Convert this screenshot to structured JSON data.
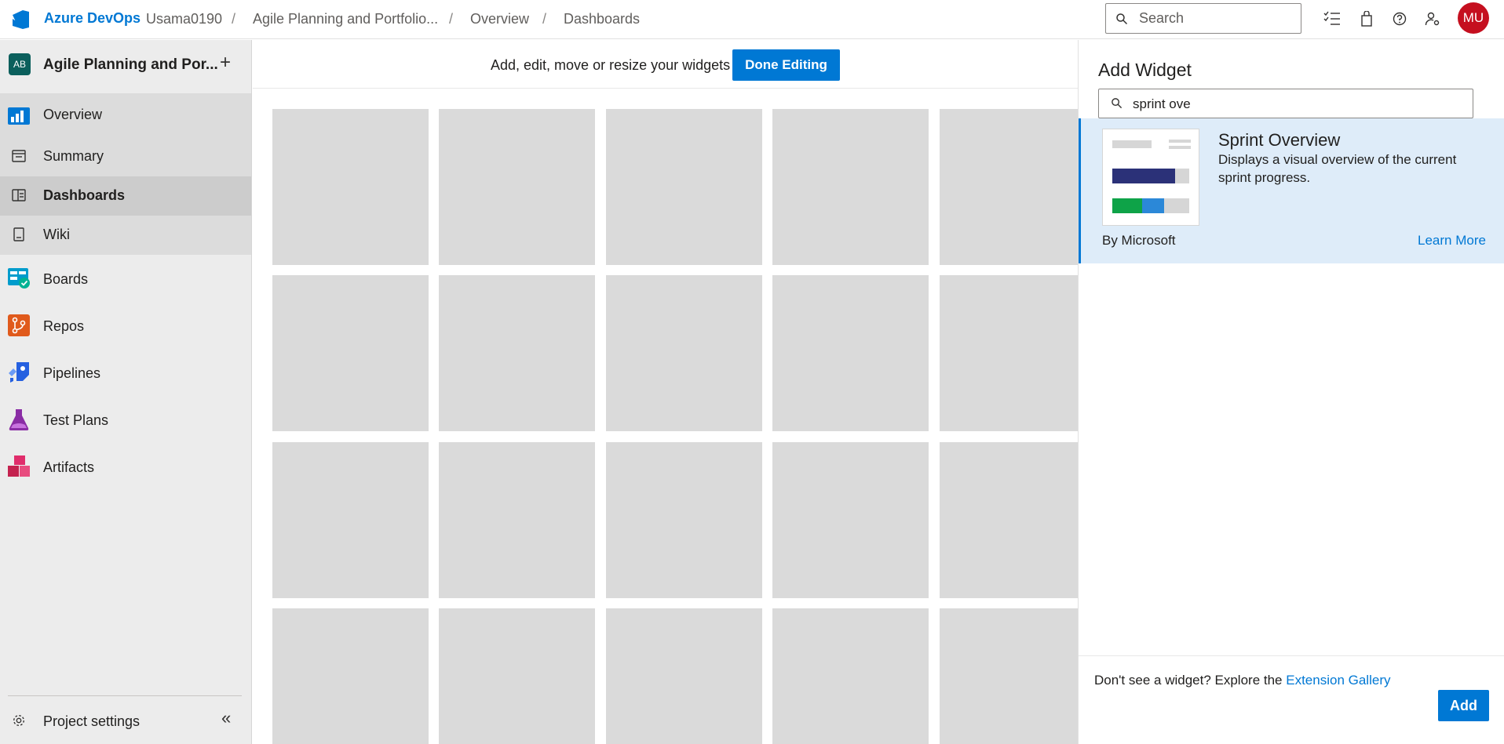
{
  "header": {
    "brand": "Azure DevOps",
    "breadcrumbs": [
      "Usama0190",
      "Agile Planning and Portfolio...",
      "Overview",
      "Dashboards"
    ],
    "separator": "/",
    "search_placeholder": "Search",
    "avatar_initials": "MU",
    "icons": [
      "task-list-icon",
      "shopping-bag-icon",
      "help-icon",
      "user-settings-icon"
    ]
  },
  "sidebar": {
    "project_initials": "AB",
    "project_name": "Agile Planning and Por...",
    "add_label": "+",
    "items": [
      {
        "label": "Overview",
        "icon": "overview-icon"
      },
      {
        "label": "Summary",
        "icon": "summary-icon"
      },
      {
        "label": "Dashboards",
        "icon": "dashboards-icon"
      },
      {
        "label": "Wiki",
        "icon": "wiki-icon"
      },
      {
        "label": "Boards",
        "icon": "boards-icon"
      },
      {
        "label": "Repos",
        "icon": "repos-icon"
      },
      {
        "label": "Pipelines",
        "icon": "pipelines-icon"
      },
      {
        "label": "Test Plans",
        "icon": "test-plans-icon"
      },
      {
        "label": "Artifacts",
        "icon": "artifacts-icon"
      }
    ],
    "settings_label": "Project settings",
    "collapse_glyph": "«"
  },
  "main": {
    "edit_message": "Add, edit, move or resize your widgets",
    "done_label": "Done Editing"
  },
  "panel": {
    "title": "Add Widget",
    "search_value": "sprint ove",
    "widget": {
      "name": "Sprint Overview",
      "description": "Displays a visual overview of the current sprint progress.",
      "publisher": "By Microsoft",
      "learn_more": "Learn More"
    },
    "footer_text": "Don't see a widget? Explore the",
    "footer_link": "Extension Gallery",
    "add_label": "Add"
  },
  "colors": {
    "accent": "#0078d4",
    "avatar": "#c50f1f",
    "selected_card": "#deecf9"
  }
}
